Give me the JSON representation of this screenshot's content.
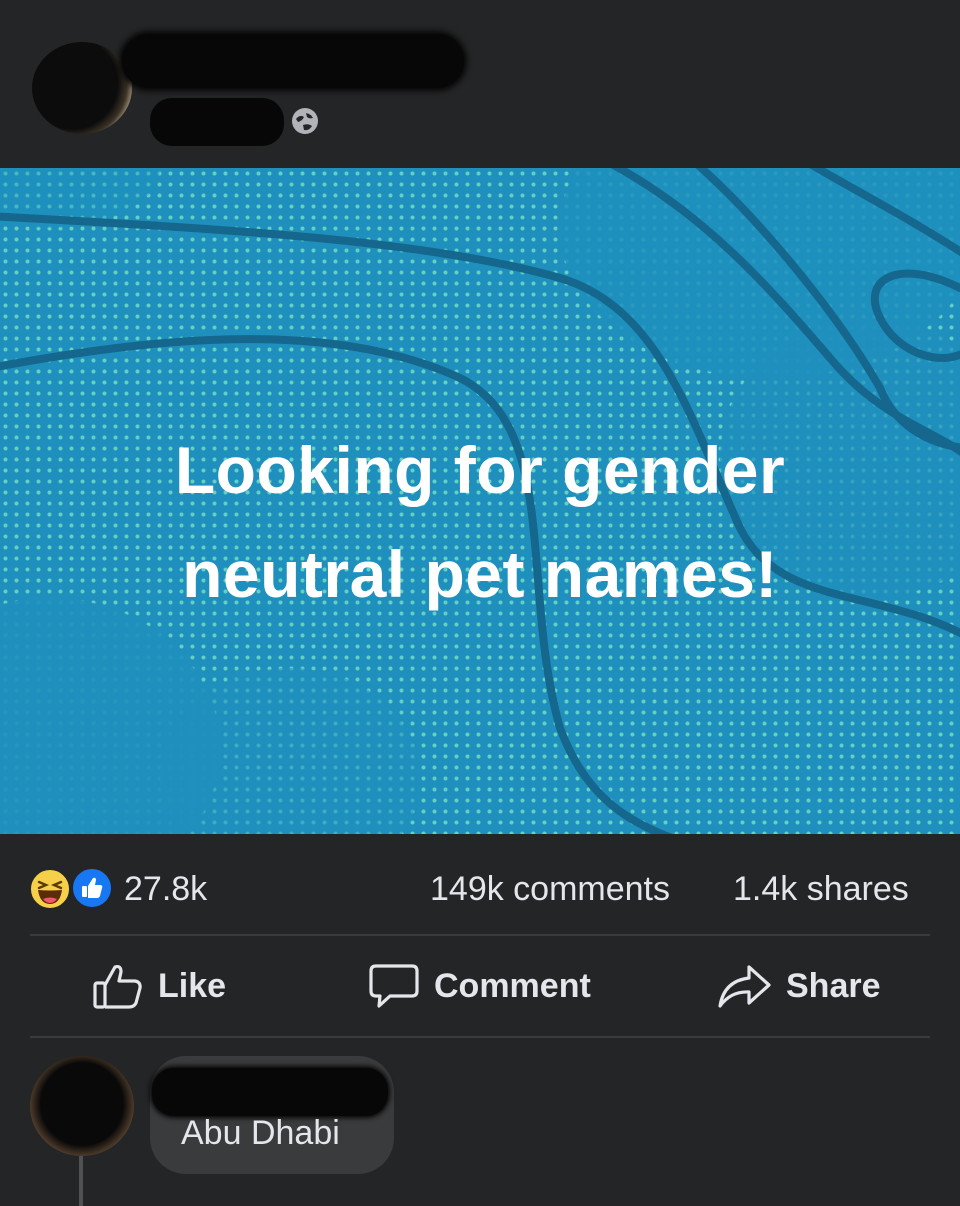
{
  "post": {
    "privacy_icon": "globe-icon",
    "text_line_1": "Looking for gender",
    "text_line_2": "neutral pet names!",
    "background_color": "#1f90bd",
    "dot_color": "#70dec4"
  },
  "stats": {
    "reactions": [
      "haha-reaction-icon",
      "like-reaction-icon"
    ],
    "reaction_count": "27.8k",
    "comments": "149k comments",
    "shares": "1.4k shares"
  },
  "actions": {
    "like_label": "Like",
    "comment_label": "Comment",
    "share_label": "Share"
  },
  "comment": {
    "text": "Abu Dhabi"
  },
  "colors": {
    "background": "#242526",
    "text": "#e4e6eb",
    "like_blue": "#1877f2",
    "haha_yellow": "#f7d04a",
    "bubble": "#3a3b3c"
  }
}
